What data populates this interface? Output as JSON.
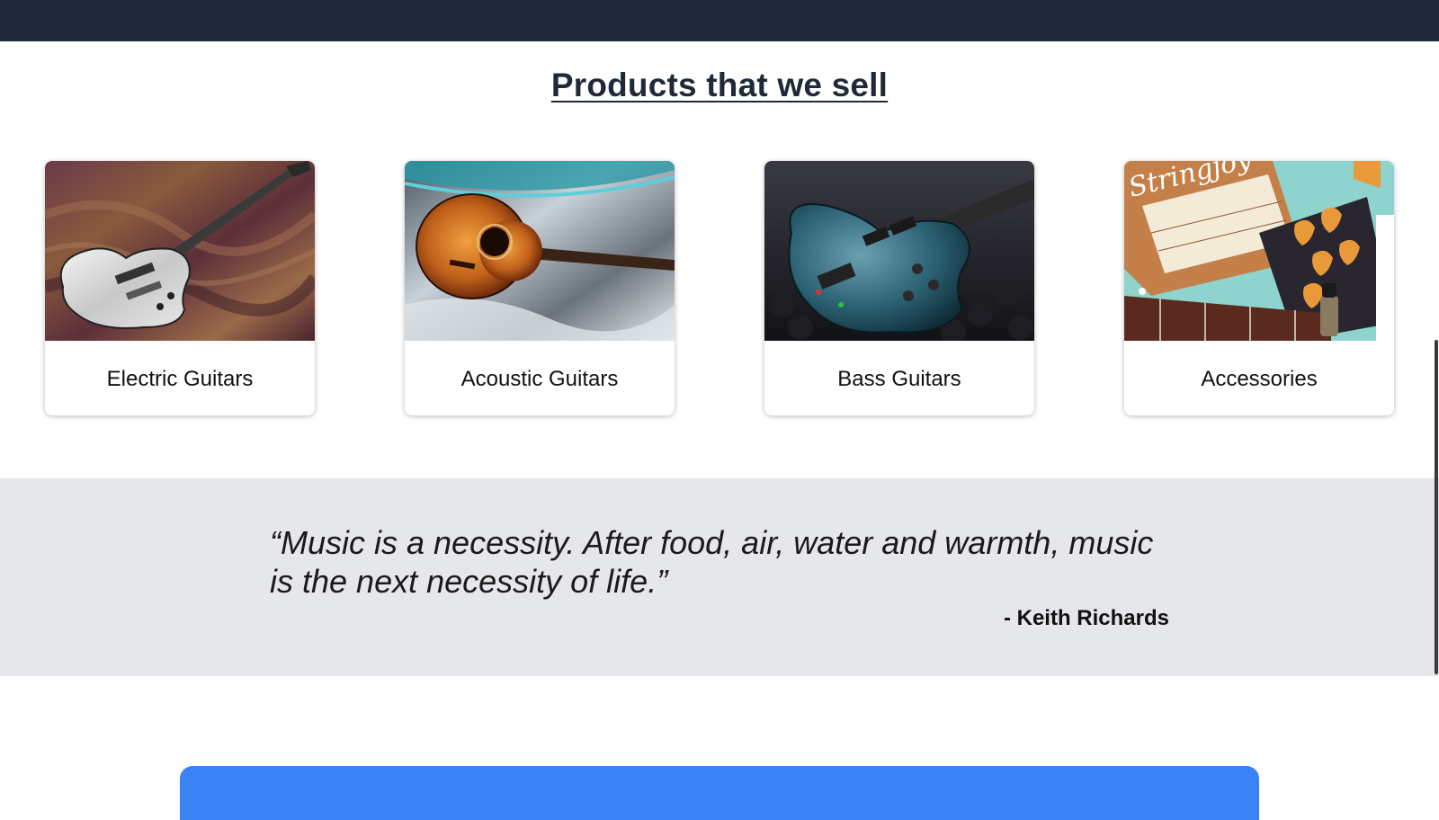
{
  "header": {
    "background": "#1f2937"
  },
  "products": {
    "title": "Products that we sell",
    "items": [
      {
        "label": "Electric Guitars",
        "image": "electric-guitar-photo"
      },
      {
        "label": "Acoustic Guitars",
        "image": "acoustic-guitar-photo"
      },
      {
        "label": "Bass Guitars",
        "image": "bass-guitar-photo"
      },
      {
        "label": "Accessories",
        "image": "accessories-photo"
      }
    ]
  },
  "quote": {
    "text": "“Music is a necessity. After food, air, water and warmth, music is the next necessity of life.”",
    "author": "- Keith Richards",
    "background": "#e5e7eb"
  },
  "cta": {
    "color": "#3b82f6"
  }
}
